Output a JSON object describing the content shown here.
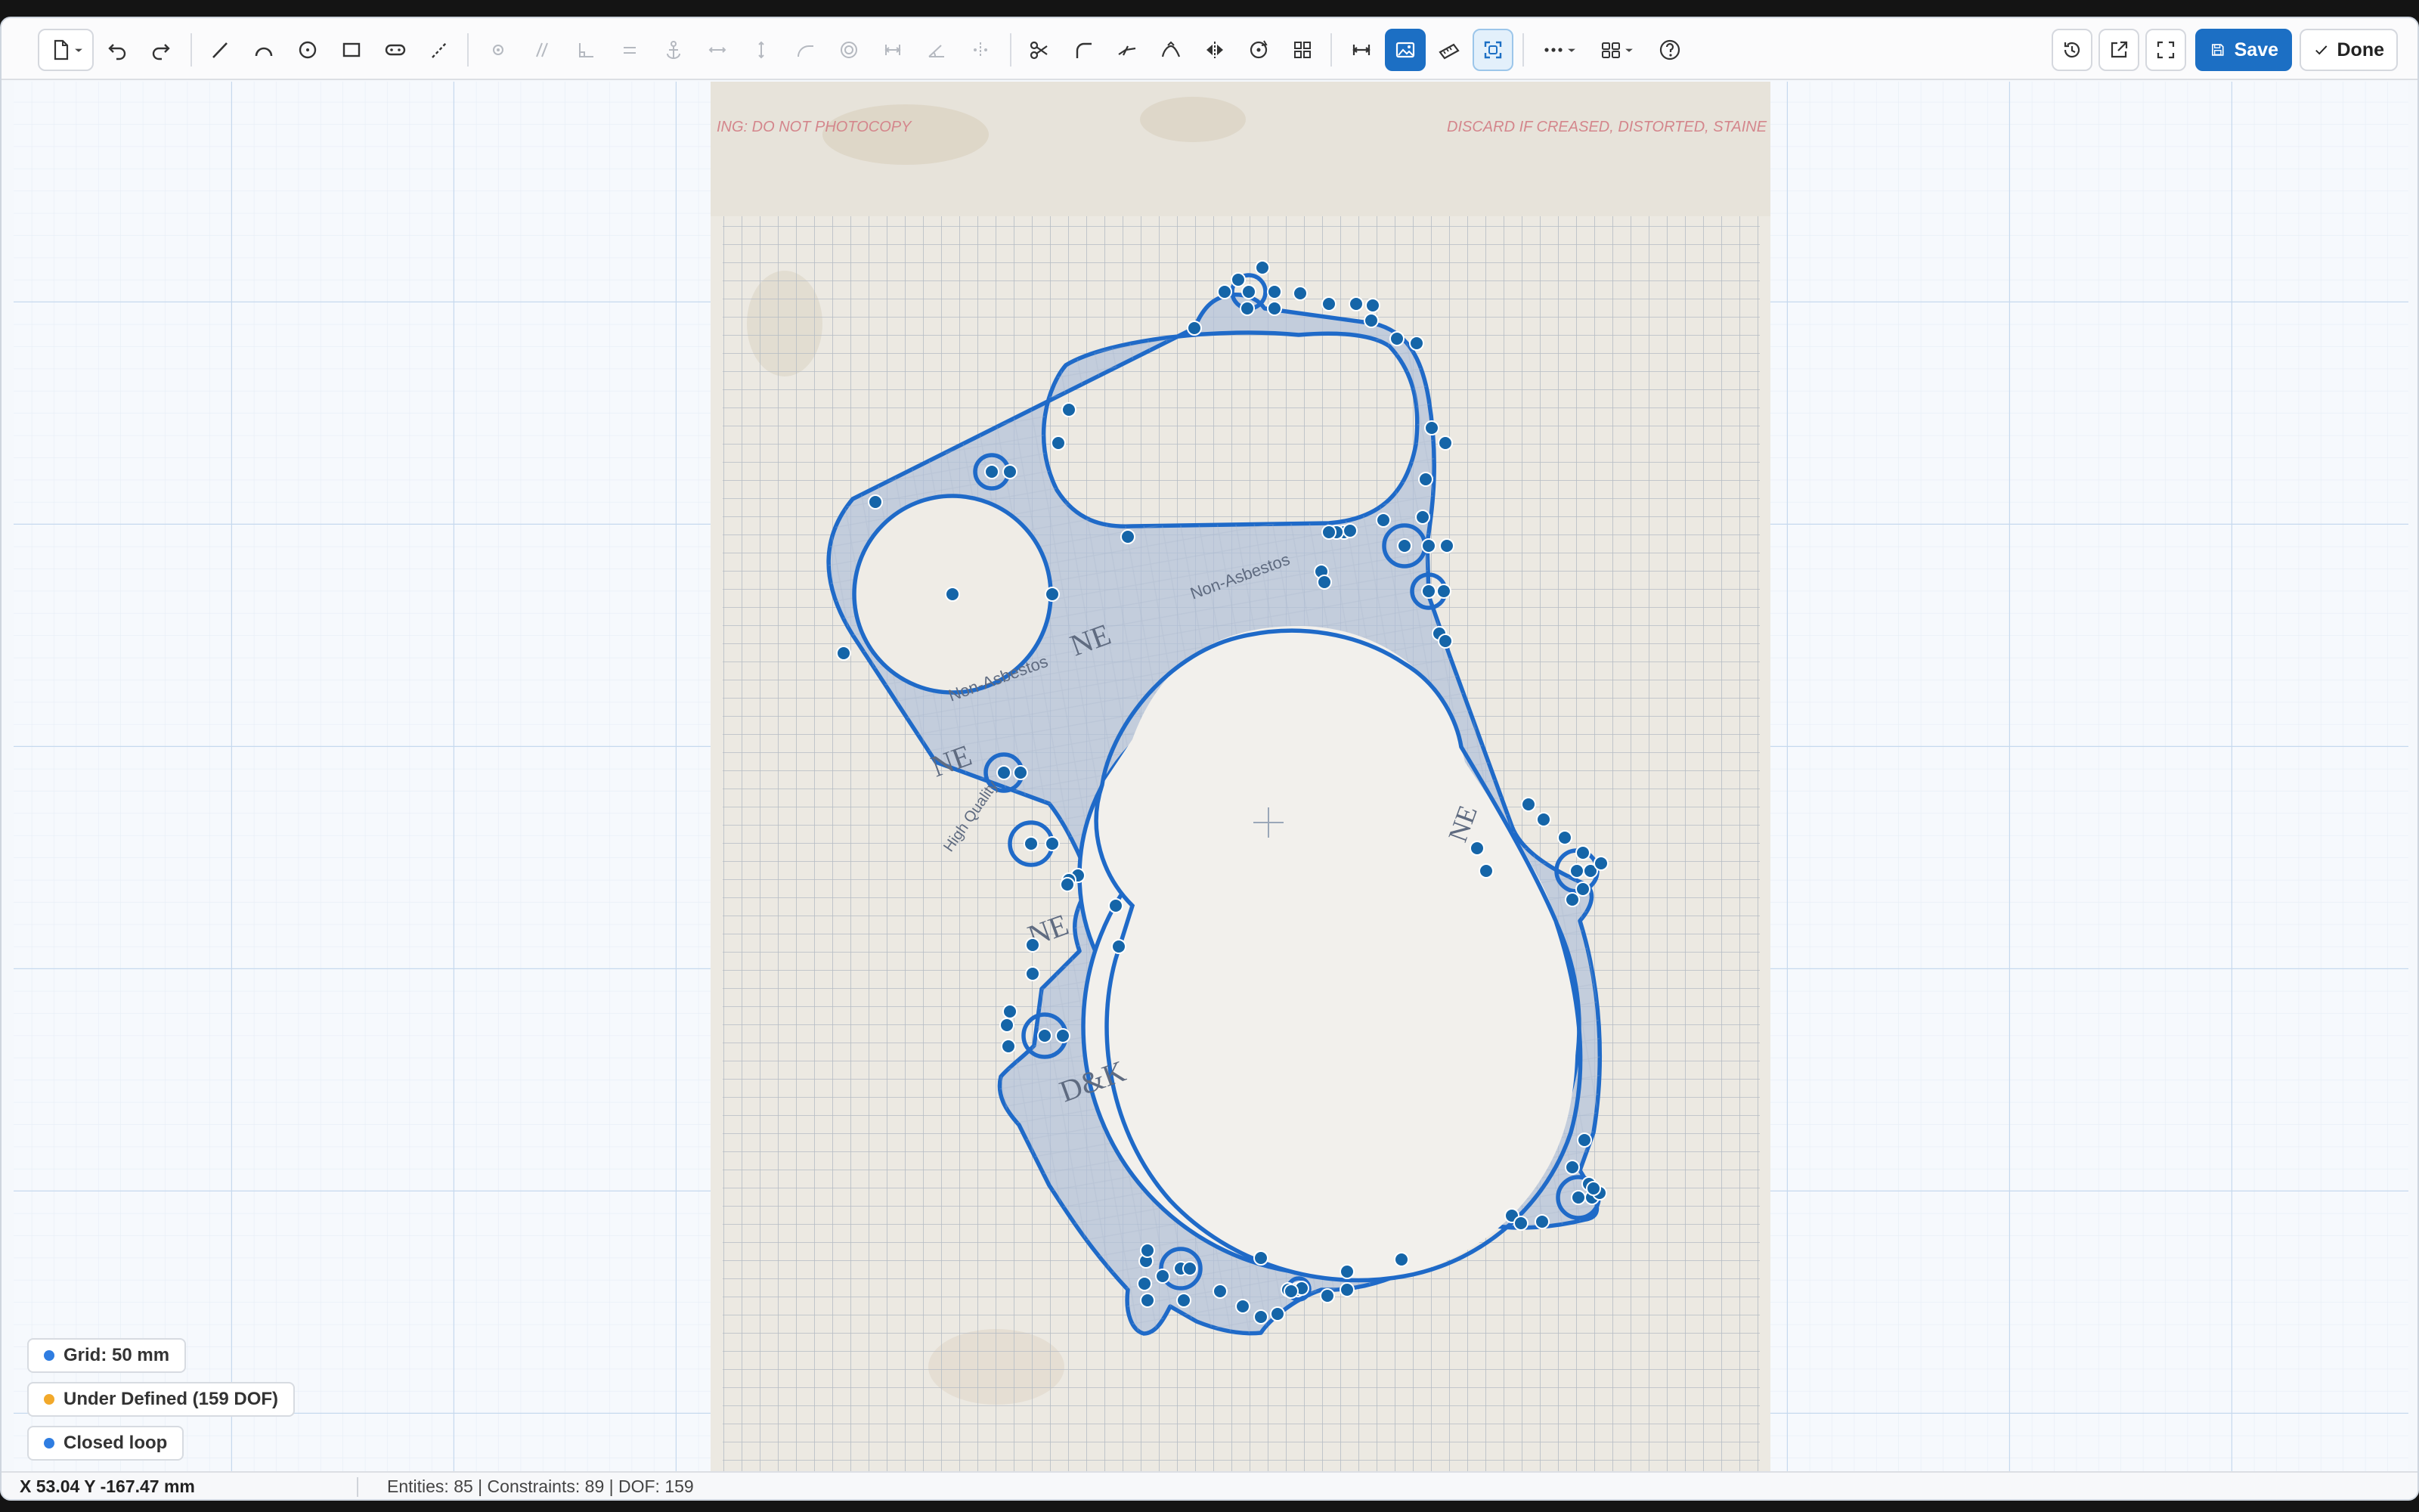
{
  "colors": {
    "accent": "#1c6fc4",
    "sketch_line": "#1f6ac8",
    "grid_minor": "#e3ebf5",
    "grid_major": "#c2d6ec",
    "status_ok": "#2f7de1",
    "status_warn": "#f2a92b"
  },
  "toolbar": {
    "file_menu_icon": "document-icon",
    "undo_icon": "undo-icon",
    "redo_icon": "redo-icon",
    "draw_tools": [
      "line-icon",
      "arc-icon",
      "circle-icon",
      "rectangle-icon",
      "slot-icon",
      "construction-line-icon"
    ],
    "constraint_tools": [
      "coincident-icon",
      "parallel-icon",
      "perpendicular-icon",
      "equal-icon",
      "fix-icon",
      "horizontal-icon",
      "vertical-icon",
      "tangent-icon",
      "concentric-icon",
      "distance-icon",
      "angle-icon",
      "symmetric-icon"
    ],
    "edit_tools": [
      "trim-icon",
      "fillet-icon",
      "extend-icon",
      "offset-icon",
      "mirror-icon",
      "rotate-icon",
      "pattern-icon"
    ],
    "view_tools": [
      "dimension-icon",
      "image-icon",
      "measure-icon",
      "fit-view-icon"
    ],
    "more_icon": "more-icon",
    "layout_icon": "layout-grid-icon",
    "help_icon": "help-icon",
    "history_icon": "history-icon",
    "export_icon": "external-link-icon",
    "fullscreen_icon": "fullscreen-icon",
    "save_label": "Save",
    "done_label": "Done"
  },
  "background_image": {
    "warning_left": "ING: DO NOT PHOTOCOPY",
    "warning_right": "DISCARD IF CREASED, DISTORTED, STAINE",
    "gasket_print": [
      "Non-Asbestos",
      "NE",
      "High Quality",
      "D&K"
    ]
  },
  "badges": {
    "grid": "Grid: 50 mm",
    "definition": "Under Defined (159 DOF)",
    "loop": "Closed loop"
  },
  "status": {
    "coords": "X 53.04 Y -167.47 mm",
    "stats": "Entities: 85 | Constraints: 89 | DOF: 159"
  }
}
